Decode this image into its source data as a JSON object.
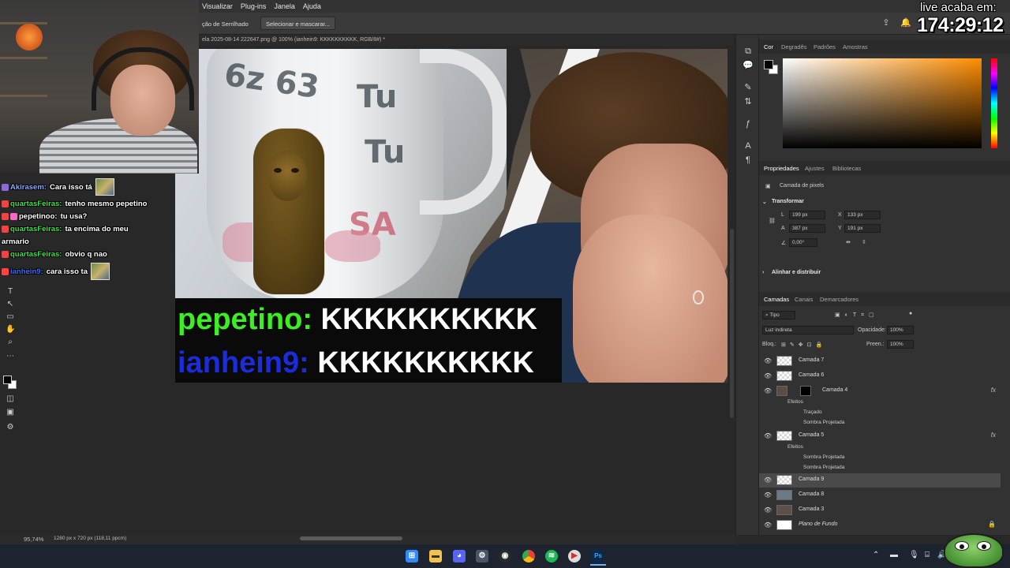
{
  "menubar": {
    "items": [
      "Visualizar",
      "Plug-ins",
      "Janela",
      "Ajuda"
    ]
  },
  "options": {
    "antialias_label": "ção de Serrilhado",
    "select_mask": "Selecionar e mascarar..."
  },
  "document": {
    "tab_title": "ela 2025-08-14 222647.png @ 100% (ianhein9: KKKKKKKKKK, RGB/8#) *"
  },
  "canvas": {
    "mug_text": [
      "6z 63",
      "Tu",
      "Tu",
      "SA"
    ],
    "caption": [
      {
        "user": "pepetino:",
        "message": "KKKKKKKKKK",
        "color": "#3bef23"
      },
      {
        "user": "ianhein9:",
        "message": "KKKKKKKKKK",
        "color": "#1b2cdc"
      }
    ]
  },
  "chat": {
    "messages": [
      {
        "user": "Akirasem:",
        "text": "Cara isso tá",
        "emote": true,
        "color": "#8aa8ff"
      },
      {
        "user": "quartasFeiras:",
        "text": "tenho mesmo pepetino",
        "emote": false,
        "color": "#3de04a"
      },
      {
        "user": "pepetinoo:",
        "text": "tu usa?",
        "emote": false,
        "color": "#ffffff"
      },
      {
        "user": "quartasFeiras:",
        "text": "ta encima do meu",
        "emote": false,
        "color": "#3de04a"
      },
      {
        "user": "",
        "text": "armario",
        "emote": false,
        "color": "#ffffff"
      },
      {
        "user": "quartasFeiras:",
        "text": "obvio q nao",
        "emote": false,
        "color": "#3de04a"
      },
      {
        "user": "ianhein9:",
        "text": "cara isso ta",
        "emote": true,
        "color": "#3a6bff"
      }
    ]
  },
  "overlay": {
    "timer_label": "live acaba em:",
    "timer": "174:29:12"
  },
  "color_panel": {
    "tabs": [
      "Cor",
      "Degradês",
      "Padrões",
      "Amostras"
    ],
    "accent": "#ff8c00"
  },
  "properties_panel": {
    "tabs": [
      "Propriedades",
      "Ajustes",
      "Bibliotecas"
    ],
    "layer_type": "Camada de pixels",
    "transform_title": "Transformar",
    "w_label": "L",
    "w_value": "199 px",
    "x_label": "X",
    "x_value": "133 px",
    "h_label": "A",
    "h_value": "387 px",
    "y_label": "Y",
    "y_value": "191 px",
    "angle_value": "0,00°",
    "align_title": "Alinhar e distribuir"
  },
  "layers_panel": {
    "tabs": [
      "Camadas",
      "Canais",
      "Demarcadores"
    ],
    "filter": "Tipo",
    "blend_mode": "Luz indireta",
    "opacity_label": "Opacidade:",
    "opacity_value": "100%",
    "lock_label": "Bloq.:",
    "fill_label": "Preen.:",
    "fill_value": "100%",
    "layers": [
      {
        "name": "Camada 7",
        "fx": false,
        "selected": false
      },
      {
        "name": "Camada 6",
        "fx": false,
        "selected": false
      },
      {
        "name": "Camada 4",
        "fx": true,
        "selected": false
      },
      {
        "name": "Camada 5",
        "fx": true,
        "selected": false
      },
      {
        "name": "Camada 9",
        "fx": false,
        "selected": true
      },
      {
        "name": "Camada 8",
        "fx": false,
        "selected": false
      },
      {
        "name": "Camada 3",
        "fx": false,
        "selected": false
      },
      {
        "name": "Plano de Fundo",
        "fx": false,
        "selected": false
      }
    ],
    "effects_label": "Efeitos",
    "layer4_effects": [
      "Traçado",
      "Sombra Projetada"
    ],
    "layer5_effects": [
      "Sombra Projetada",
      "Sombra Projetada"
    ]
  },
  "statusbar": {
    "zoom": "95,74%",
    "doc_info": "1280 px x 720 px (118,11 ppcm)"
  },
  "taskbar": {
    "icons": [
      "windows",
      "files",
      "discord",
      "settings",
      "obs",
      "chrome",
      "spotify",
      "media",
      "photoshop"
    ]
  }
}
